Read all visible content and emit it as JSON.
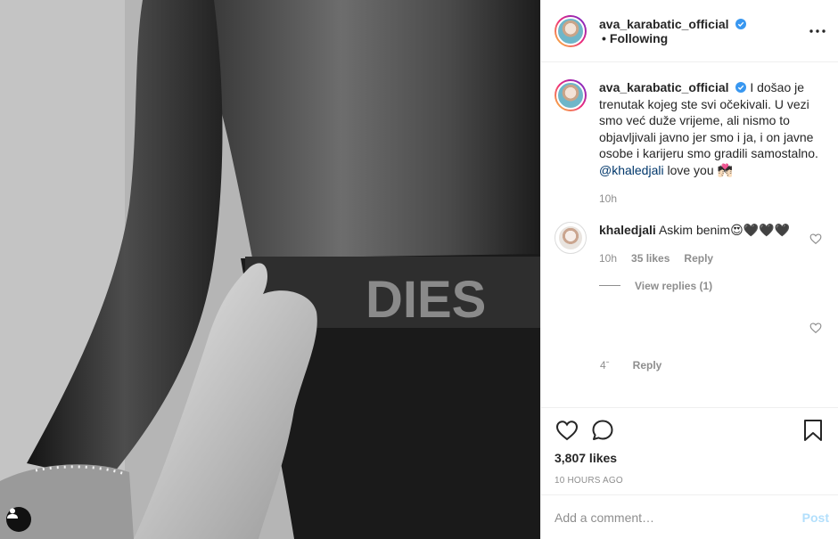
{
  "post": {
    "username": "ava_karabatic_official",
    "dot": "•",
    "follow_label": "Following",
    "caption_user": "ava_karabatic_official",
    "caption_text": "I došao je trenutak kojeg ste svi očekivali. U vezi smo već duže vrijeme, ali nismo to objavljivali javno jer smo i ja, i on javne osobe i karijeru smo gradili samostalno.",
    "caption_mention": "@khaledjali",
    "caption_tail": "love you 💏🏻",
    "caption_time": "10h"
  },
  "comments": [
    {
      "user": "khaledjali",
      "text": "Askim benim😍🖤🖤🖤",
      "time": "10h",
      "likes": "35 likes",
      "reply_label": "Reply",
      "view_replies": "View replies (1)"
    }
  ],
  "ghost_comment": {
    "time": "4ˉ",
    "reply_label": "Reply"
  },
  "stats": {
    "likes": "3,807 likes",
    "posted": "10 HOURS AGO"
  },
  "comment_input": {
    "placeholder": "Add a comment…",
    "post_label": "Post"
  },
  "icons": {
    "like": "heart-icon",
    "comment": "comment-bubble-icon",
    "save": "bookmark-icon",
    "more": "more-options-icon",
    "tag": "user-tag-icon",
    "verified": "verified-badge-icon"
  },
  "colors": {
    "link": "#00376b",
    "verified": "#3897f0",
    "post_disabled": "#b2dffc",
    "muted": "#8e8e8e"
  }
}
